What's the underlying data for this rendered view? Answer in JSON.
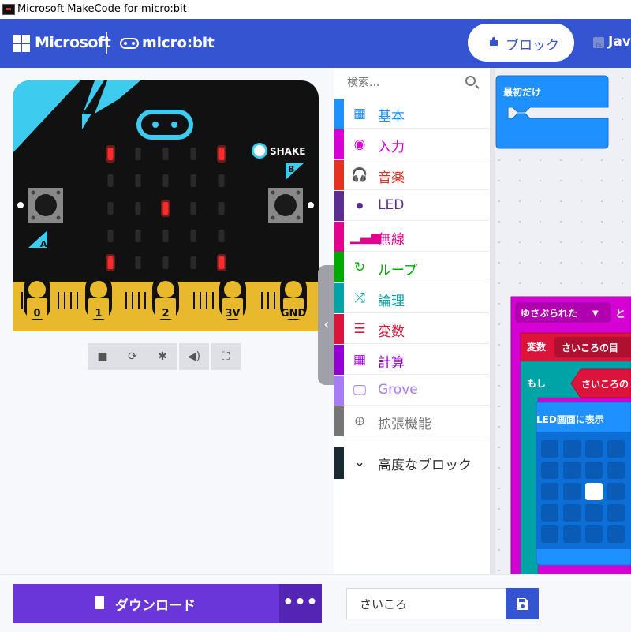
{
  "window": {
    "title": "Microsoft MakeCode for micro:bit"
  },
  "header": {
    "brand": "Microsoft",
    "product": "micro:bit",
    "tabs": [
      {
        "label": "ブロック",
        "active": true
      },
      {
        "label": "Jav",
        "active": false
      }
    ]
  },
  "simulator": {
    "shake_label": "SHAKE",
    "button_a": "A",
    "button_b": "B",
    "pins": [
      "0",
      "1",
      "2",
      "3V",
      "GND"
    ],
    "led_matrix": [
      [
        1,
        0,
        0,
        0,
        1
      ],
      [
        0,
        0,
        0,
        0,
        0
      ],
      [
        0,
        0,
        1,
        0,
        0
      ],
      [
        0,
        0,
        0,
        0,
        0
      ],
      [
        1,
        0,
        0,
        0,
        1
      ]
    ],
    "tools": [
      "stop-icon",
      "restart-icon",
      "debug-icon",
      "mute-icon",
      "fullscreen-icon"
    ]
  },
  "toolbox": {
    "search_placeholder": "検索...",
    "categories": [
      {
        "label": "基本",
        "color": "#1e90ff",
        "icon": "grid-icon"
      },
      {
        "label": "入力",
        "color": "#d400d4",
        "icon": "circle-dot-icon"
      },
      {
        "label": "音楽",
        "color": "#e63022",
        "icon": "headphones-icon"
      },
      {
        "label": "LED",
        "color": "#5c2d91",
        "icon": "toggle-icon"
      },
      {
        "label": "無線",
        "color": "#e3008c",
        "icon": "signal-bars-icon"
      },
      {
        "label": "ループ",
        "color": "#00aa00",
        "icon": "loop-arrow-icon"
      },
      {
        "label": "論理",
        "color": "#00a4a6",
        "icon": "shuffle-icon"
      },
      {
        "label": "変数",
        "color": "#dc143c",
        "icon": "list-lines-icon"
      },
      {
        "label": "計算",
        "color": "#9400d3",
        "icon": "calculator-icon"
      },
      {
        "label": "Grove",
        "color": "#a87cf5",
        "icon": "monitor-icon"
      },
      {
        "label": "拡張機能",
        "color": "#757575",
        "icon": "plus-circle-icon"
      },
      {
        "label": "高度なブロック",
        "color": "#1a2a33",
        "icon": "chevron-down-icon"
      }
    ]
  },
  "workspace": {
    "on_start_label": "最初だけ",
    "gesture_dropdown": "ゆさぶられた",
    "gesture_suffix": "と",
    "var_set_label": "変数",
    "var_name": "さいころの目",
    "if_label": "もし",
    "if_var": "さいころの",
    "show_leds_label": "LED画面に表示",
    "leds": [
      [
        0,
        0,
        0,
        0
      ],
      [
        0,
        0,
        0,
        0
      ],
      [
        0,
        0,
        1,
        0
      ],
      [
        0,
        0,
        0,
        0
      ],
      [
        0,
        0,
        0,
        0
      ]
    ]
  },
  "footer": {
    "download_label": "ダウンロード",
    "more_label": "•••",
    "project_name": "さいころ"
  }
}
